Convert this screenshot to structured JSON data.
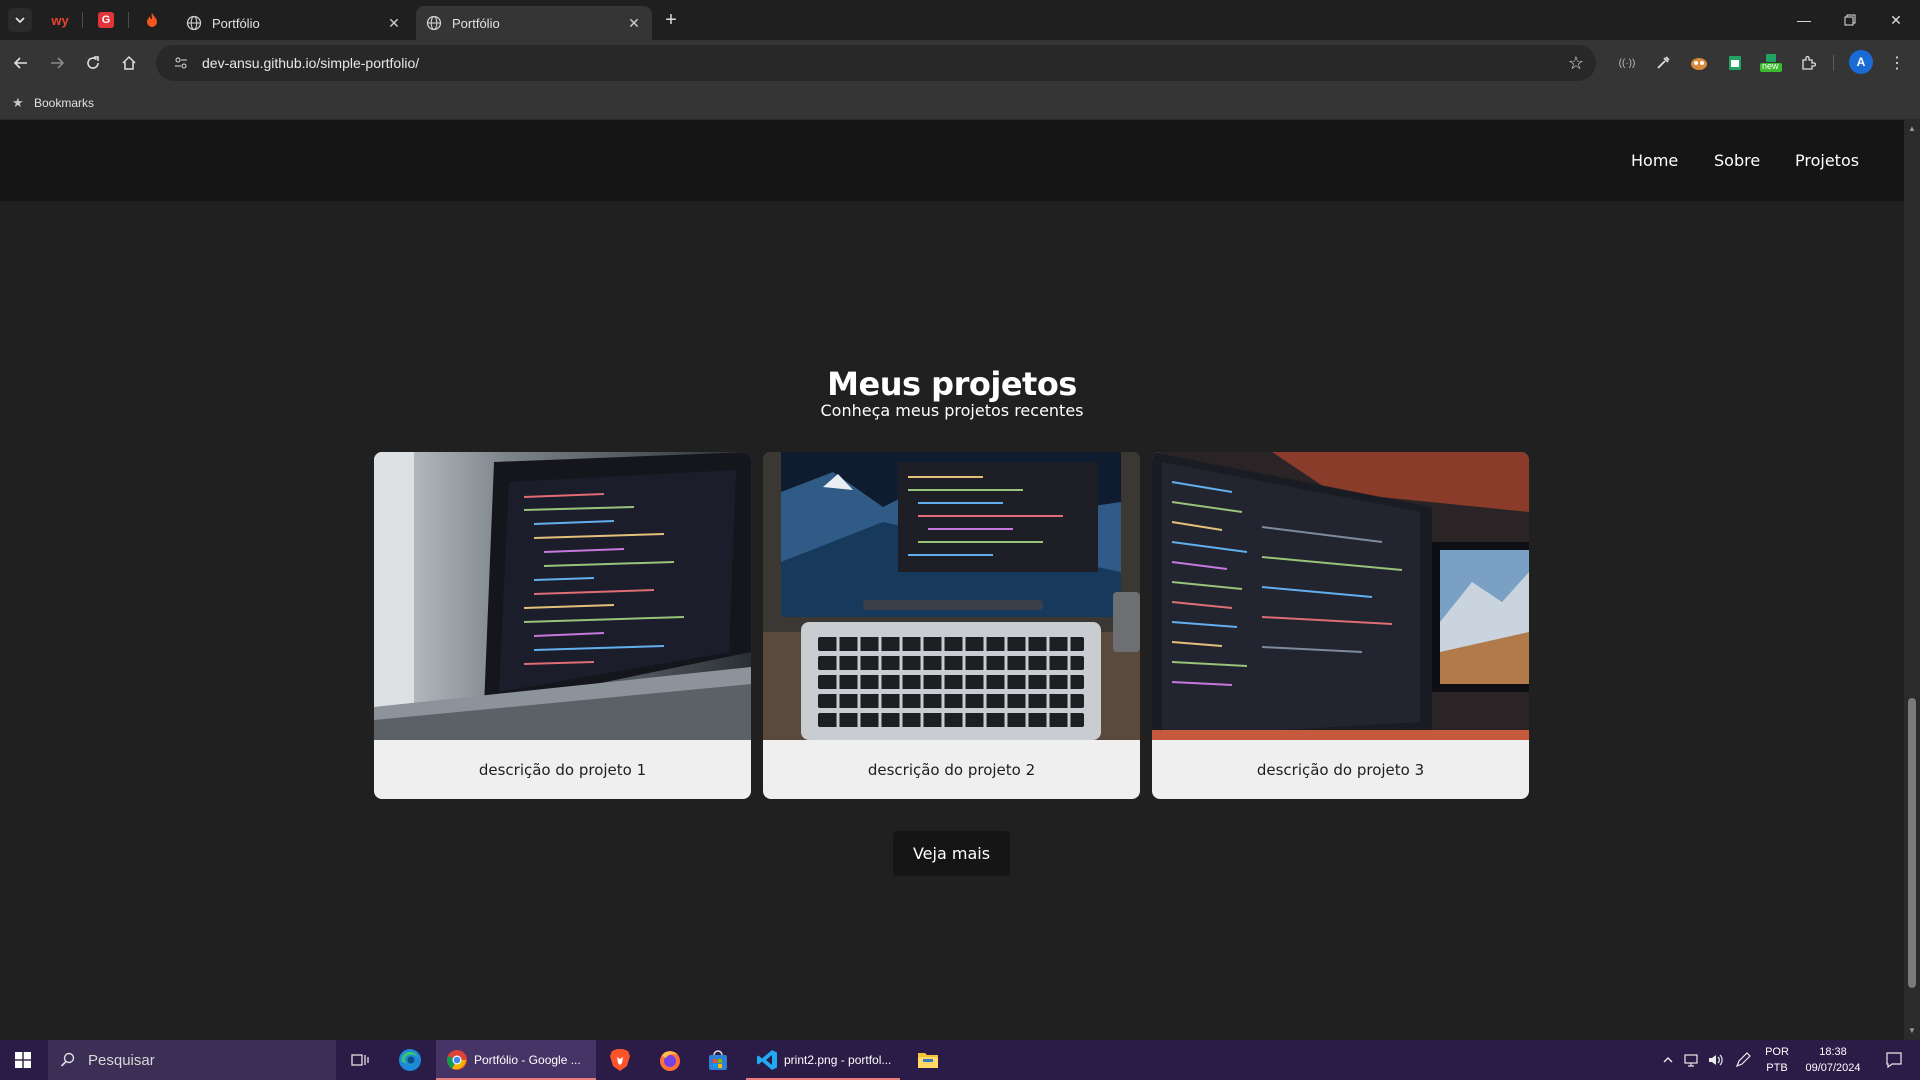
{
  "browser": {
    "tabs": [
      {
        "title": "Portfólio",
        "active": false
      },
      {
        "title": "Portfólio",
        "active": true
      }
    ],
    "url": "dev-ansu.github.io/simple-portfolio/",
    "bookmarks_label": "Bookmarks",
    "profile_initial": "A",
    "extension_badge": "new"
  },
  "site": {
    "nav": [
      "Home",
      "Sobre",
      "Projetos"
    ],
    "section_title": "Meus projetos",
    "section_subtitle": "Conheça meus projetos recentes",
    "projects": [
      {
        "description": "descrição do projeto 1"
      },
      {
        "description": "descrição do projeto 2"
      },
      {
        "description": "descrição do projeto 3"
      }
    ],
    "more_button": "Veja mais"
  },
  "taskbar": {
    "search_placeholder": "Pesquisar",
    "apps": [
      {
        "label": "Portfólio - Google ..."
      },
      {
        "label": "print2.png - portfol..."
      }
    ],
    "language": [
      "POR",
      "PTB"
    ],
    "time": "18:38",
    "date": "09/07/2024"
  },
  "colors": {
    "page_bg": "#202020",
    "nav_bg": "#151515",
    "card_bg": "#efefef",
    "taskbar_bg": "#2a1b47"
  }
}
